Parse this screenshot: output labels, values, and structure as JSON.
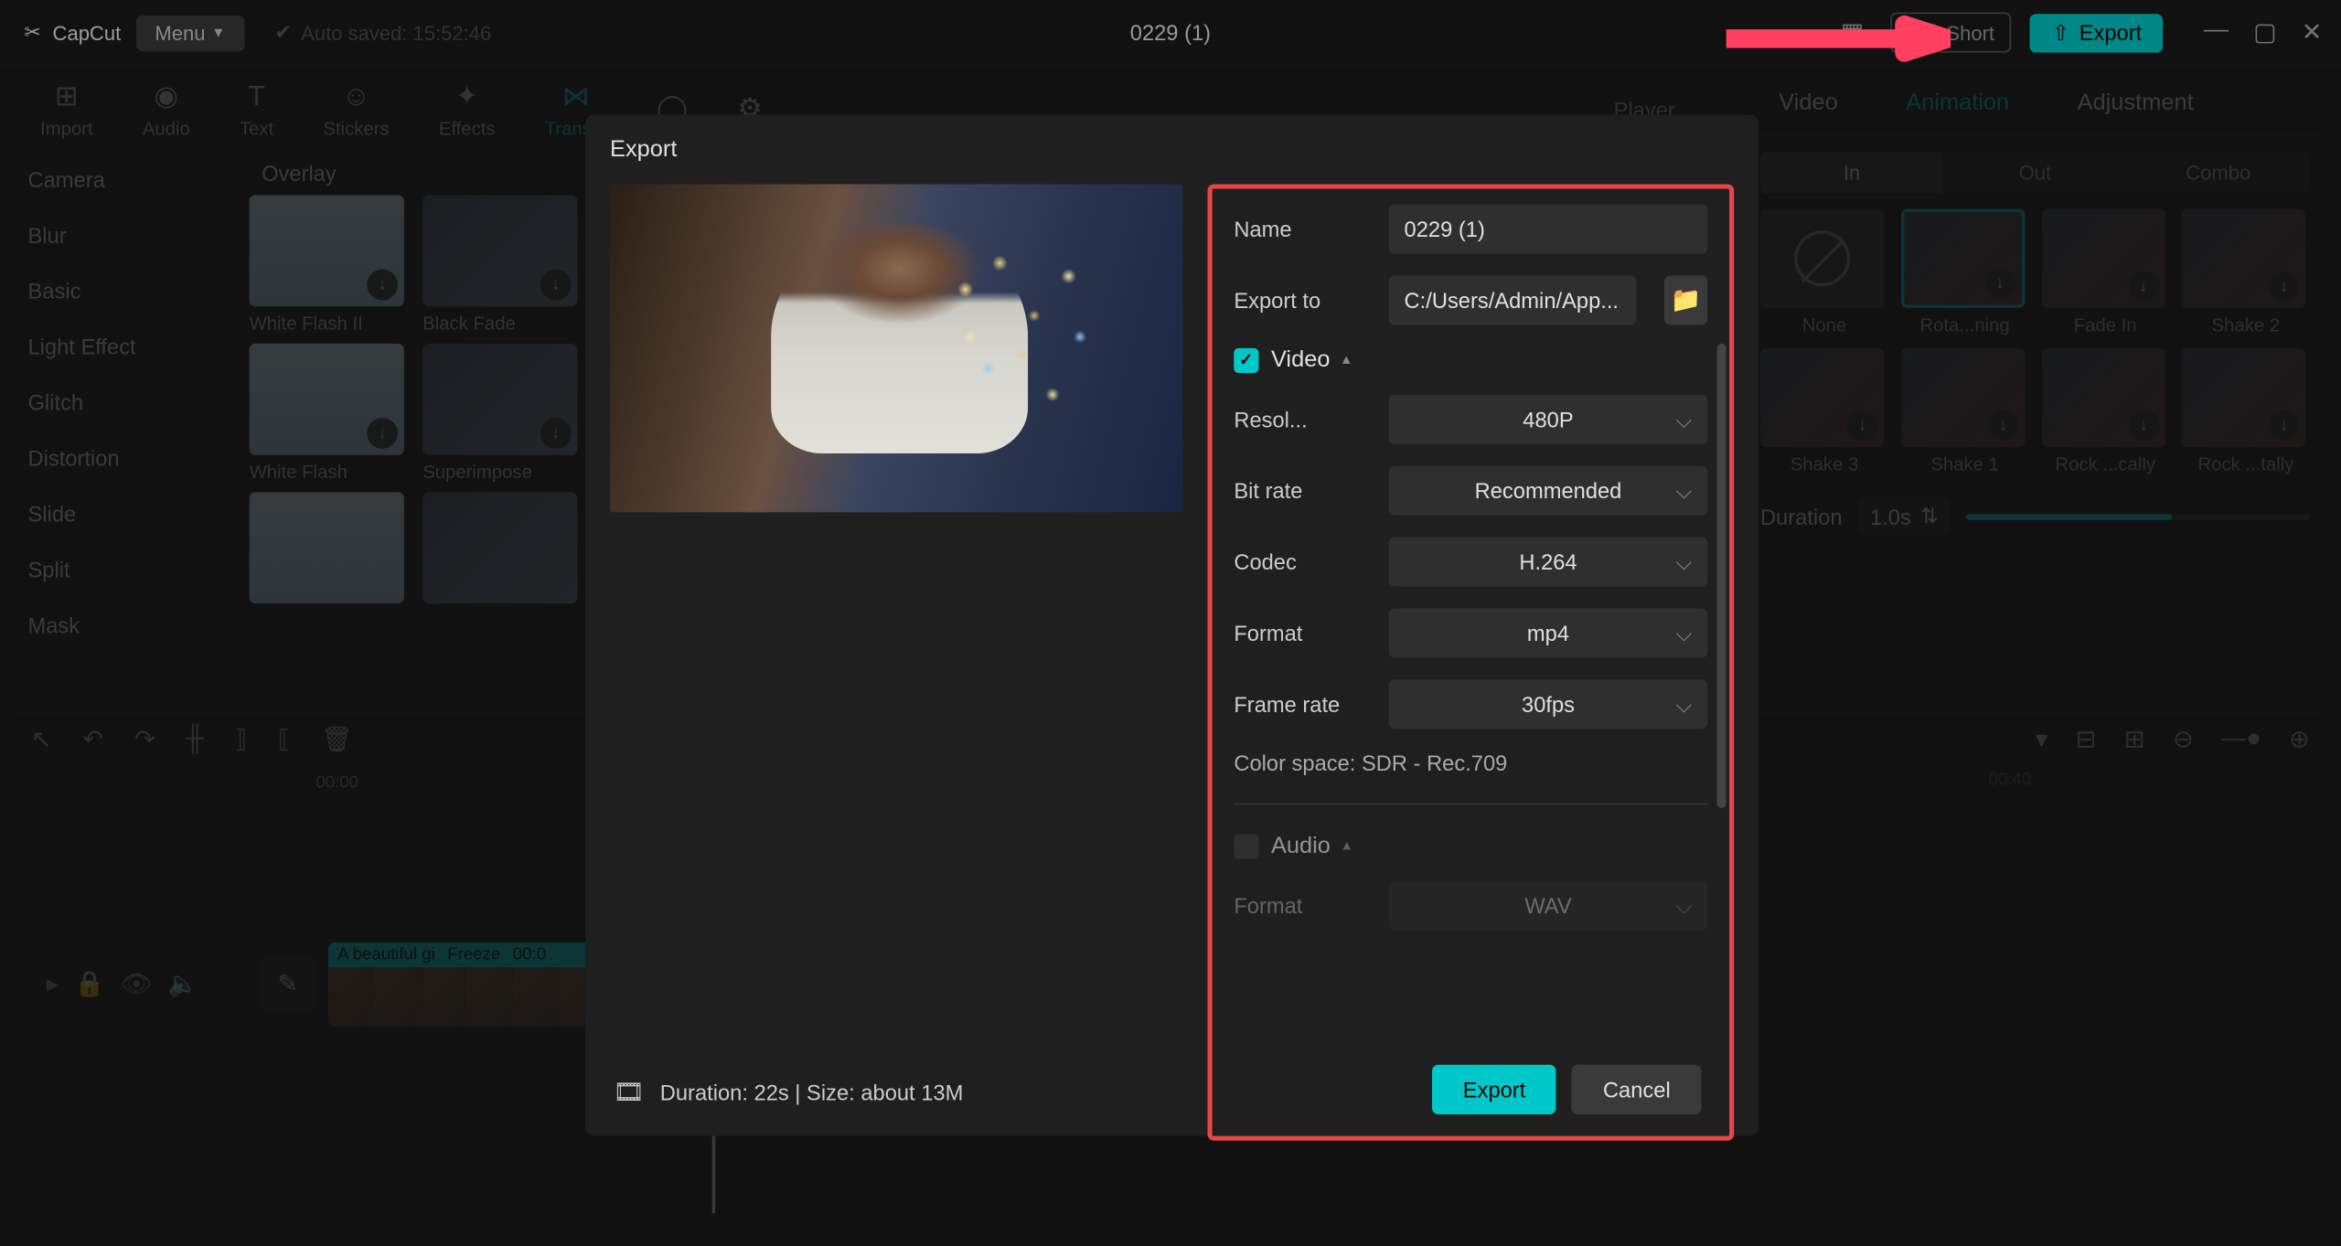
{
  "app": {
    "name": "CapCut",
    "menu_label": "Menu",
    "auto_saved": "Auto saved: 15:52:46",
    "project_title": "0229 (1)",
    "shortcut_label": "Short",
    "export_label": "Export"
  },
  "toolbar": {
    "items": [
      "Import",
      "Audio",
      "Text",
      "Stickers",
      "Effects",
      "Trans...",
      "",
      "",
      ""
    ],
    "active_index": 5,
    "player_label": "Player"
  },
  "sidebar": {
    "items": [
      "Camera",
      "Blur",
      "Basic",
      "Light Effect",
      "Glitch",
      "Distortion",
      "Slide",
      "Split",
      "Mask"
    ]
  },
  "effects": {
    "section": "Overlay",
    "thumbs": [
      {
        "label": "White Flash II",
        "kind": "flash"
      },
      {
        "label": "Black Fade",
        "kind": "dark"
      },
      {
        "label": "White Flash",
        "kind": "flash"
      },
      {
        "label": "Superimpose",
        "kind": "dark"
      },
      {
        "label": "",
        "kind": "flash"
      },
      {
        "label": "",
        "kind": "dark"
      }
    ]
  },
  "right_panel": {
    "tabs": [
      "Video",
      "Animation",
      "Adjustment"
    ],
    "active_tab": 1,
    "sub_tabs": [
      "In",
      "Out",
      "Combo"
    ],
    "active_sub": 0,
    "animations": [
      {
        "label": "None",
        "none": true
      },
      {
        "label": "Rota...ning",
        "selected": true
      },
      {
        "label": "Fade In"
      },
      {
        "label": "Shake 2"
      },
      {
        "label": "Shake 3"
      },
      {
        "label": "Shake 1"
      },
      {
        "label": "Rock ...cally"
      },
      {
        "label": "Rock ...tally"
      }
    ],
    "duration_label": "Duration",
    "duration_value": "1.0s"
  },
  "timeline": {
    "marks": [
      "00:00",
      "00:40"
    ],
    "clip_labels": [
      "A beautiful gi",
      "Freeze",
      "00:0"
    ]
  },
  "export_dialog": {
    "title": "Export",
    "name_label": "Name",
    "name_value": "0229 (1)",
    "path_label": "Export to",
    "path_value": "C:/Users/Admin/App...",
    "video_section": "Video",
    "audio_section": "Audio",
    "rows": {
      "resolution": {
        "label": "Resol...",
        "value": "480P"
      },
      "bitrate": {
        "label": "Bit rate",
        "value": "Recommended"
      },
      "codec": {
        "label": "Codec",
        "value": "H.264"
      },
      "format": {
        "label": "Format",
        "value": "mp4"
      },
      "framerate": {
        "label": "Frame rate",
        "value": "30fps"
      },
      "audio_format": {
        "label": "Format",
        "value": "WAV"
      }
    },
    "color_space": "Color space: SDR - Rec.709",
    "duration_info": "Duration: 22s | Size: about 13M",
    "export_btn": "Export",
    "cancel_btn": "Cancel"
  }
}
